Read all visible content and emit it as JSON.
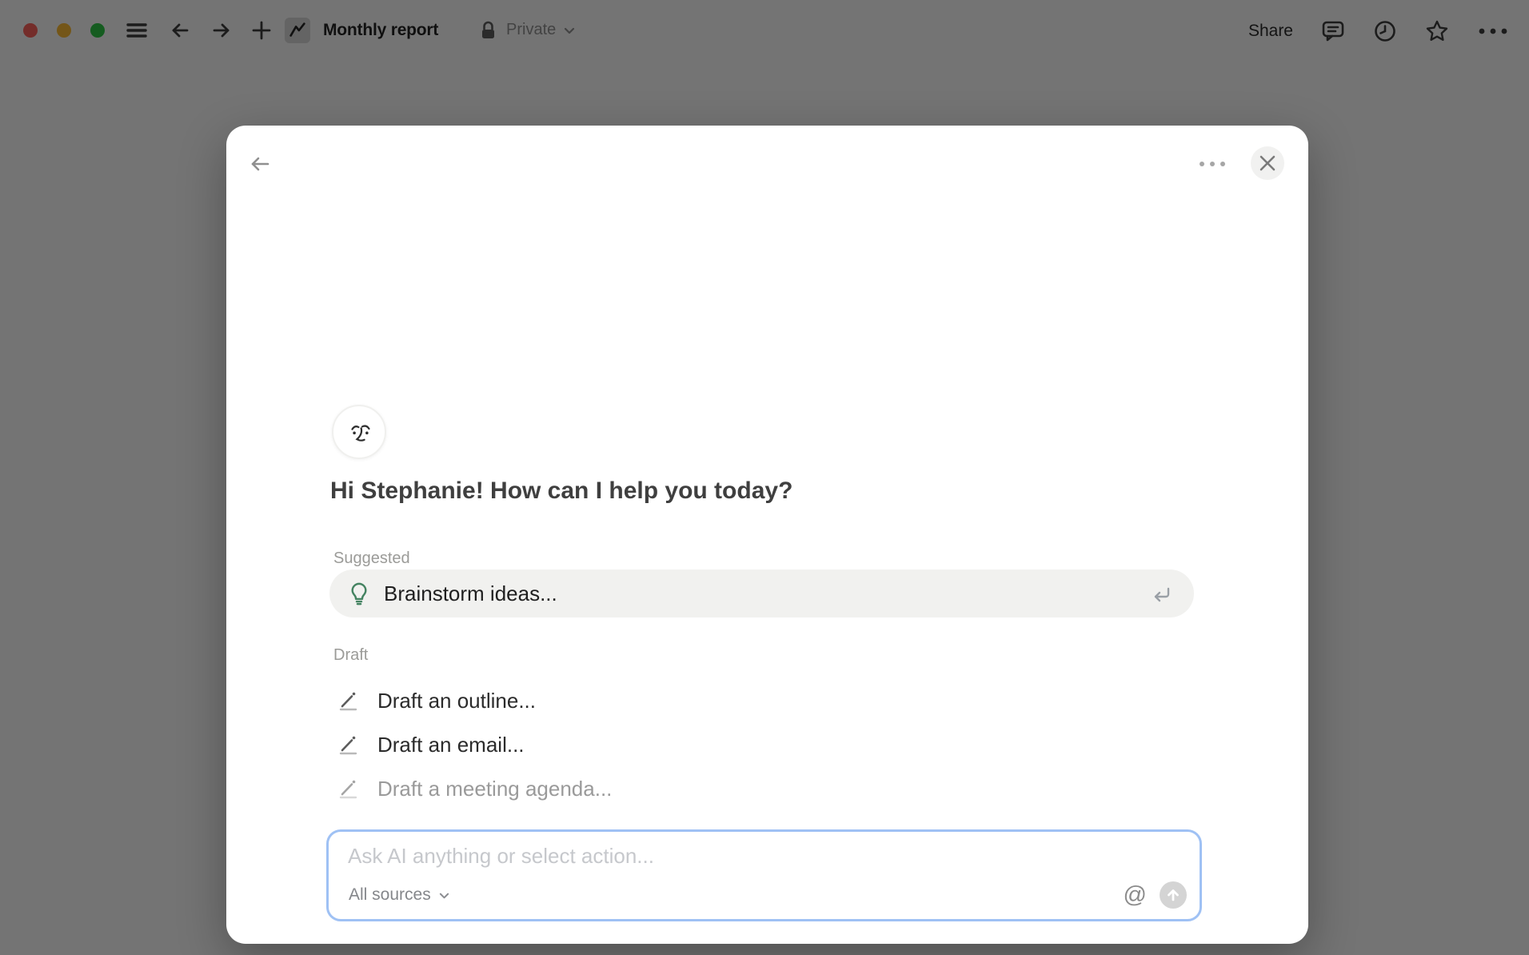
{
  "topbar": {
    "title": "Monthly report",
    "privacy_label": "Private",
    "share_label": "Share"
  },
  "modal": {
    "greeting": "Hi Stephanie! How can I help you today?",
    "suggested": {
      "label": "Suggested",
      "items": [
        {
          "icon": "lightbulb-icon",
          "label": "Brainstorm ideas..."
        }
      ]
    },
    "draft": {
      "label": "Draft",
      "items": [
        {
          "icon": "pencil-icon",
          "label": "Draft an outline..."
        },
        {
          "icon": "pencil-icon",
          "label": "Draft an email..."
        },
        {
          "icon": "pencil-icon",
          "label": "Draft a meeting agenda..."
        }
      ]
    },
    "input": {
      "placeholder": "Ask AI anything or select action...",
      "source_selector_label": "All sources"
    }
  },
  "colors": {
    "traffic-red": "#ff5f57",
    "traffic-yellow": "#febc2e",
    "traffic-green": "#28c840",
    "accent-blue": "#9fc1f4",
    "bulb-green": "#448361",
    "overlay": "rgba(8,8,8,0.56)"
  }
}
